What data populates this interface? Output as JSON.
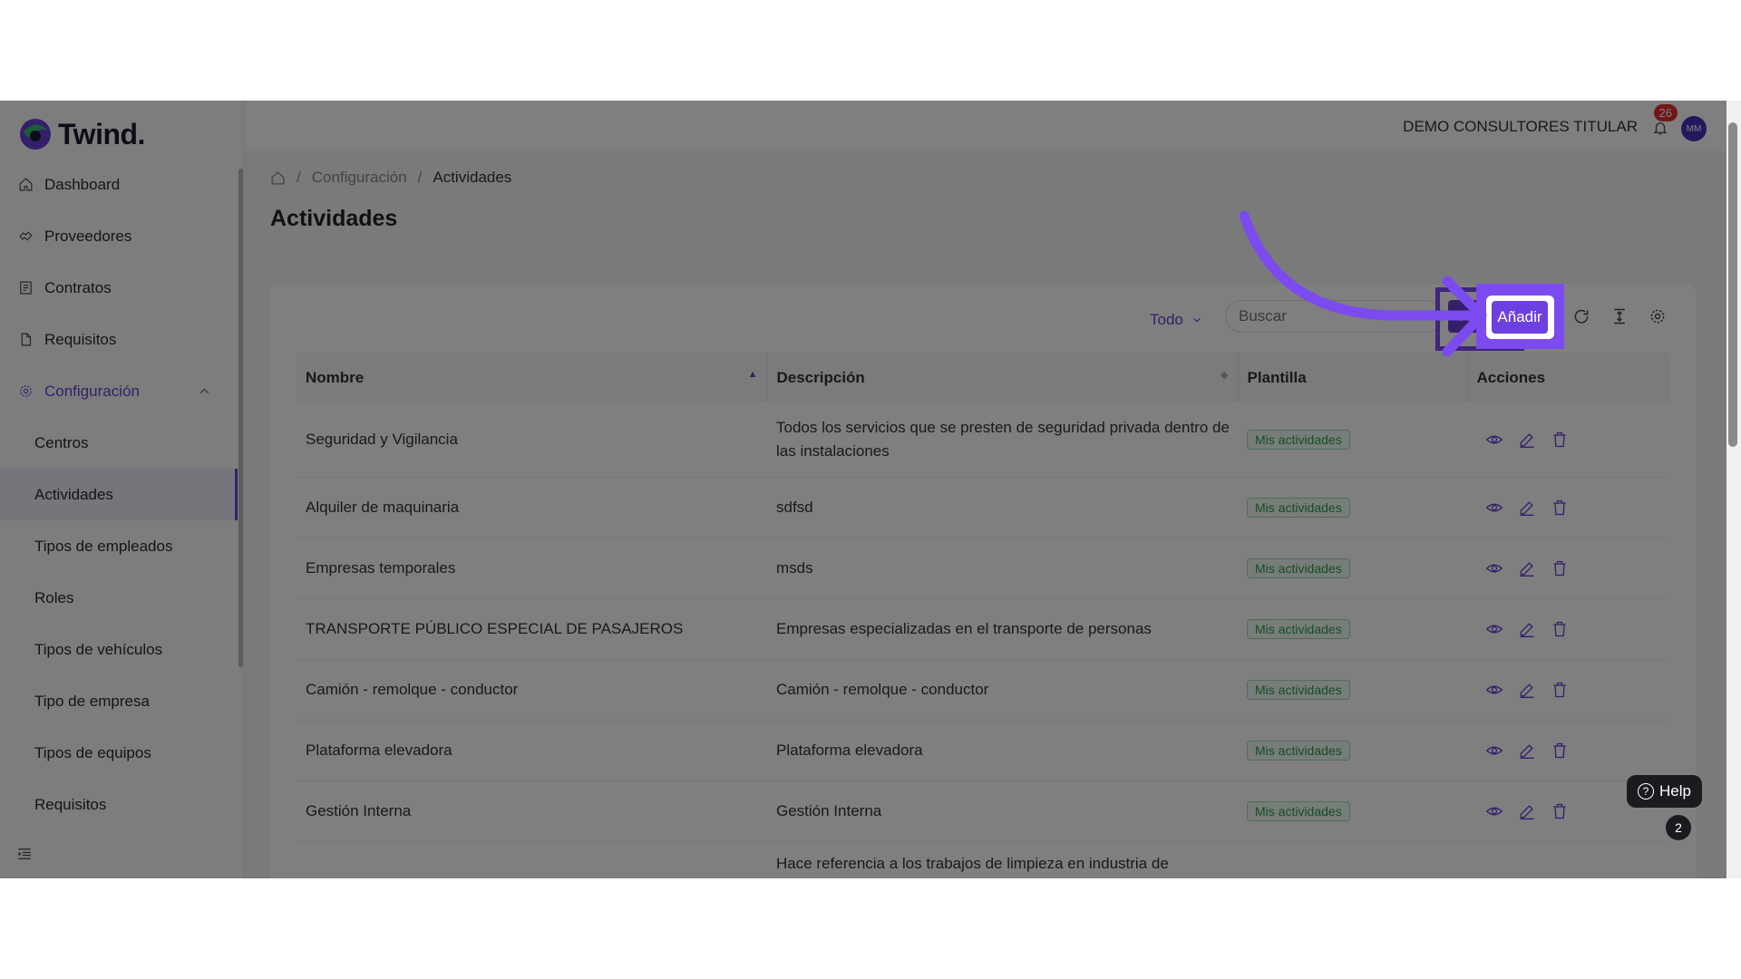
{
  "brand": {
    "name": "Twind."
  },
  "sidebar": {
    "items": [
      {
        "label": "Dashboard",
        "icon": "home-icon"
      },
      {
        "label": "Proveedores",
        "icon": "handshake-icon"
      },
      {
        "label": "Contratos",
        "icon": "contract-icon"
      },
      {
        "label": "Requisitos",
        "icon": "document-icon"
      },
      {
        "label": "Configuración",
        "icon": "gear-icon"
      }
    ],
    "subitems": [
      {
        "label": "Centros"
      },
      {
        "label": "Actividades"
      },
      {
        "label": "Tipos de empleados"
      },
      {
        "label": "Roles"
      },
      {
        "label": "Tipos de vehículos"
      },
      {
        "label": "Tipo de empresa"
      },
      {
        "label": "Tipos de equipos"
      },
      {
        "label": "Requisitos"
      }
    ]
  },
  "topbar": {
    "company": "DEMO CONSULTORES TITULAR",
    "notifications": "26",
    "avatar": "MM"
  },
  "breadcrumb": {
    "level1": "Configuración",
    "current": "Actividades"
  },
  "page": {
    "title": "Actividades"
  },
  "toolbar": {
    "filter": "Todo",
    "search_placeholder": "Buscar",
    "add_label": "Añadir"
  },
  "table": {
    "headers": {
      "name": "Nombre",
      "description": "Descripción",
      "template": "Plantilla",
      "actions": "Acciones"
    },
    "rows": [
      {
        "name": "Seguridad y Vigilancia",
        "description": "Todos los servicios que se presten de seguridad privada dentro de las instalaciones",
        "template": "Mis actividades"
      },
      {
        "name": "Alquiler de maquinaria",
        "description": "sdfsd",
        "template": "Mis actividades"
      },
      {
        "name": "Empresas temporales",
        "description": "msds",
        "template": "Mis actividades"
      },
      {
        "name": "TRANSPORTE PÚBLICO ESPECIAL DE PASAJEROS",
        "description": "Empresas especializadas en el transporte de personas",
        "template": "Mis actividades"
      },
      {
        "name": "Camión - remolque - conductor",
        "description": "Camión - remolque - conductor",
        "template": "Mis actividades"
      },
      {
        "name": "Plataforma elevadora",
        "description": "Plataforma elevadora",
        "template": "Mis actividades"
      },
      {
        "name": "Gestión Interna",
        "description": "Gestión Interna",
        "template": "Mis actividades"
      },
      {
        "name": "",
        "description": "Hace referencia a los trabajos de limpieza en industria de",
        "template": ""
      }
    ]
  },
  "help": {
    "label": "Help",
    "count": "2"
  },
  "colors": {
    "accent": "#6b3fd6",
    "highlight": "#7b4bf0",
    "tag_green": "#2e9a4d"
  }
}
